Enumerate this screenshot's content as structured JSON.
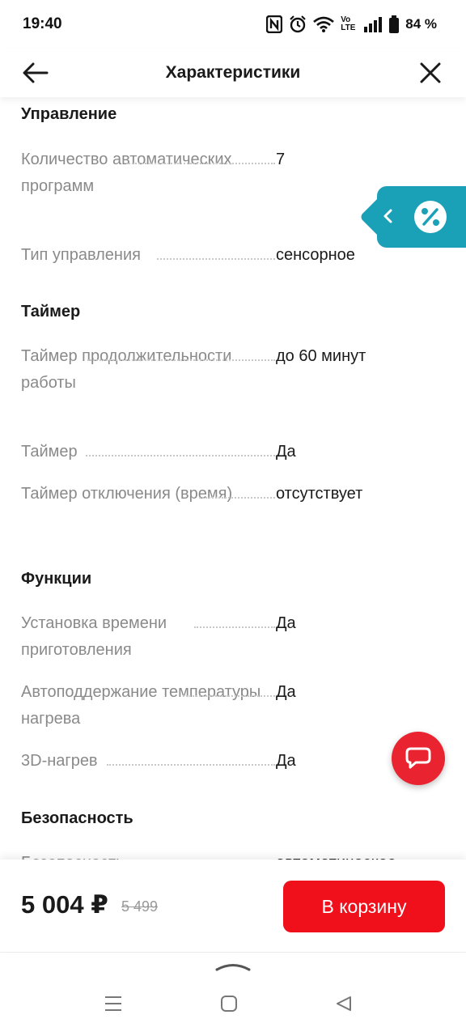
{
  "status_bar": {
    "time": "19:40",
    "battery": "84 %",
    "network": "Vo LTE"
  },
  "header": {
    "title": "Характеристики"
  },
  "sections": [
    {
      "title": "Управление",
      "specs": [
        {
          "name": "Количество автоматических программ",
          "value": "7"
        },
        {
          "name": "Тип управления",
          "value": "сенсорное"
        }
      ]
    },
    {
      "title": "Таймер",
      "specs": [
        {
          "name": "Таймер продолжительности работы",
          "value": "до 60 минут"
        },
        {
          "name": "Таймер",
          "value": "Да"
        },
        {
          "name": "Таймер отключения (время)",
          "value": "отсутствует"
        }
      ]
    },
    {
      "title": "Функции",
      "specs": [
        {
          "name": "Установка времени приготовления",
          "value": "Да"
        },
        {
          "name": "Автоподдержание температуры нагрева",
          "value": "Да"
        },
        {
          "name": "3D-нагрев",
          "value": "Да"
        }
      ]
    },
    {
      "title": "Безопасность",
      "specs": [
        {
          "name": "Безопасность",
          "value": "автоматическое"
        }
      ]
    }
  ],
  "purchase": {
    "price": "5 004 ₽",
    "old_price": "5 499",
    "cart_label": "В корзину"
  },
  "colors": {
    "accent_red": "#f0101c",
    "promo_teal": "#1aa1b8"
  },
  "icons": {
    "back": "arrow-left-icon",
    "close": "close-icon",
    "promo": "percent-icon",
    "chat": "chat-icon"
  }
}
